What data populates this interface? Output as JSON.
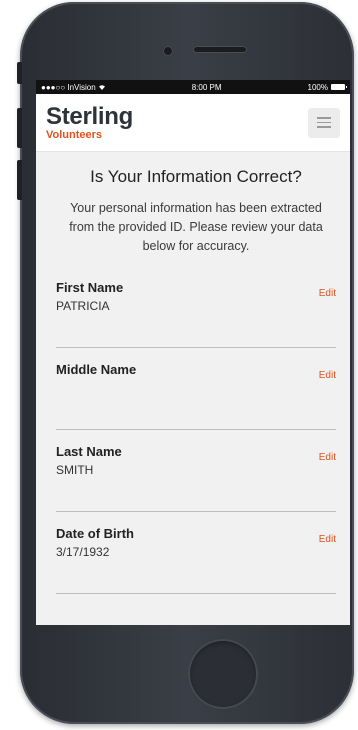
{
  "status_bar": {
    "carrier": "●●●○○ InVision",
    "time": "8:00 PM",
    "battery": "100%"
  },
  "header": {
    "logo_main": "Sterling",
    "logo_sub": "Volunteers",
    "menu_icon": "hamburger-icon"
  },
  "page": {
    "title": "Is Your Information Correct?",
    "intro": "Your personal information has been extracted from the provided ID. Please review your data below for accuracy."
  },
  "fields": [
    {
      "label": "First Name",
      "value": "PATRICIA",
      "edit": "Edit"
    },
    {
      "label": "Middle Name",
      "value": "",
      "edit": "Edit"
    },
    {
      "label": "Last Name",
      "value": "SMITH",
      "edit": "Edit"
    },
    {
      "label": "Date of Birth",
      "value": "3/17/1932",
      "edit": "Edit"
    }
  ],
  "colors": {
    "accent": "#e1521e",
    "logo_dark": "#2e3338",
    "background": "#f1f1f1"
  }
}
